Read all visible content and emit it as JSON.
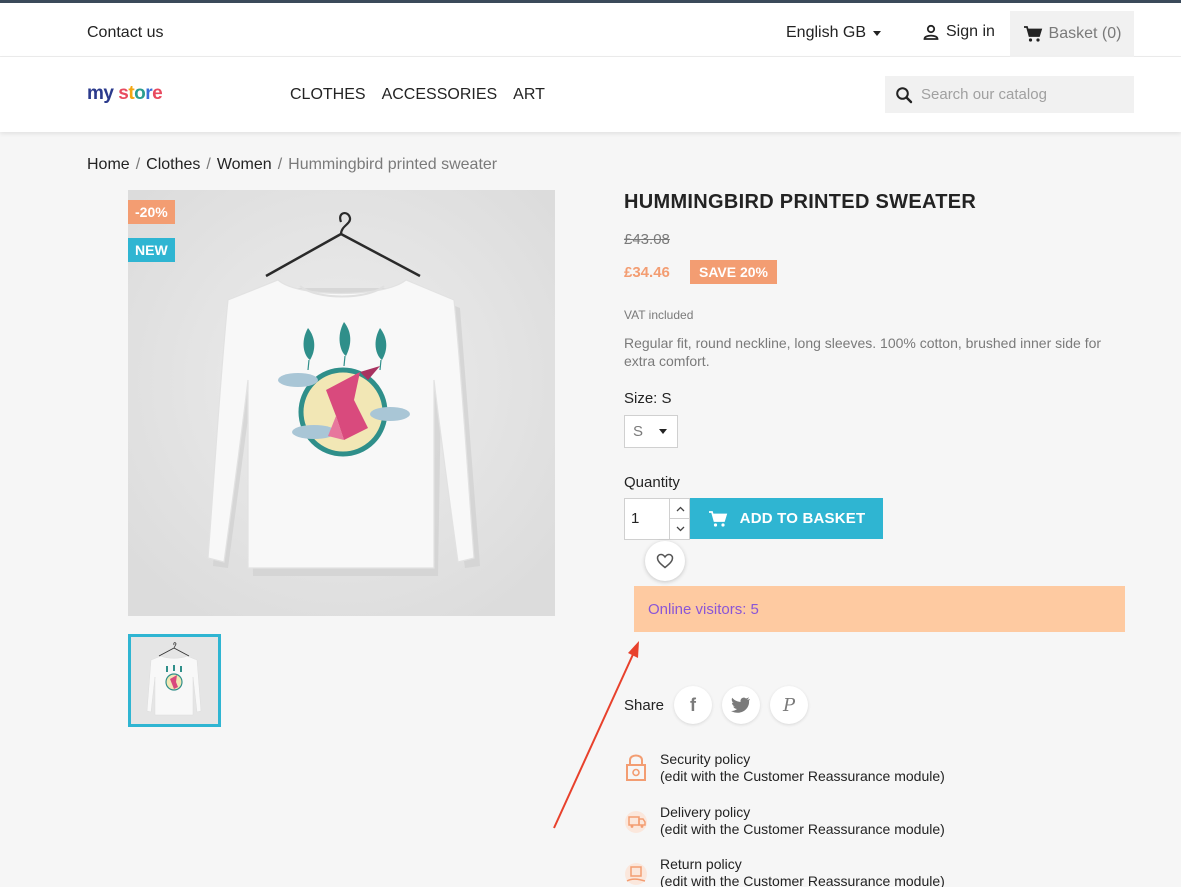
{
  "header": {
    "contact_label": "Contact us",
    "language": "English GB",
    "signin_label": "Sign in",
    "basket_label": "Basket (0)"
  },
  "logo": {
    "part1": "my",
    "part2_letters": [
      "s",
      "t",
      "o",
      "r",
      "e"
    ]
  },
  "menu": {
    "items": [
      {
        "label": "CLOTHES"
      },
      {
        "label": "ACCESSORIES"
      },
      {
        "label": "ART"
      }
    ]
  },
  "search": {
    "placeholder": "Search our catalog"
  },
  "breadcrumb": {
    "items": [
      {
        "label": "Home"
      },
      {
        "label": "Clothes"
      },
      {
        "label": "Women"
      }
    ],
    "current": "Hummingbird printed sweater",
    "separator": "/"
  },
  "product": {
    "badge_discount": "-20%",
    "badge_new": "NEW",
    "title": "HUMMINGBIRD PRINTED SWEATER",
    "old_price": "£43.08",
    "price": "£34.46",
    "save_label": "SAVE 20%",
    "vat": "VAT included",
    "description": "Regular fit, round neckline, long sleeves. 100% cotton, brushed inner side for extra comfort.",
    "size_label": "Size: S",
    "size_value": "S",
    "quantity_label": "Quantity",
    "quantity_value": "1",
    "add_to_basket_label": "ADD TO BASKET"
  },
  "visitors": {
    "text": "Online visitors: 5"
  },
  "share": {
    "label": "Share",
    "networks": [
      {
        "icon": "facebook-icon",
        "glyph": "f"
      },
      {
        "icon": "twitter-icon"
      },
      {
        "icon": "pinterest-icon",
        "glyph": "P"
      }
    ]
  },
  "reassurance": [
    {
      "title": "Security policy",
      "subtitle": "(edit with the Customer Reassurance module)",
      "icon": "lock-icon"
    },
    {
      "title": "Delivery policy",
      "subtitle": "(edit with the Customer Reassurance module)",
      "icon": "truck-icon"
    },
    {
      "title": "Return policy",
      "subtitle": "(edit with the Customer Reassurance module)",
      "icon": "return-icon"
    }
  ],
  "colors": {
    "accent": "#2fb5d2",
    "price": "#f39d72",
    "visitors_bg": "#fecaa1",
    "visitors_text": "#8a56d6",
    "annotation_arrow": "#e8412c"
  }
}
